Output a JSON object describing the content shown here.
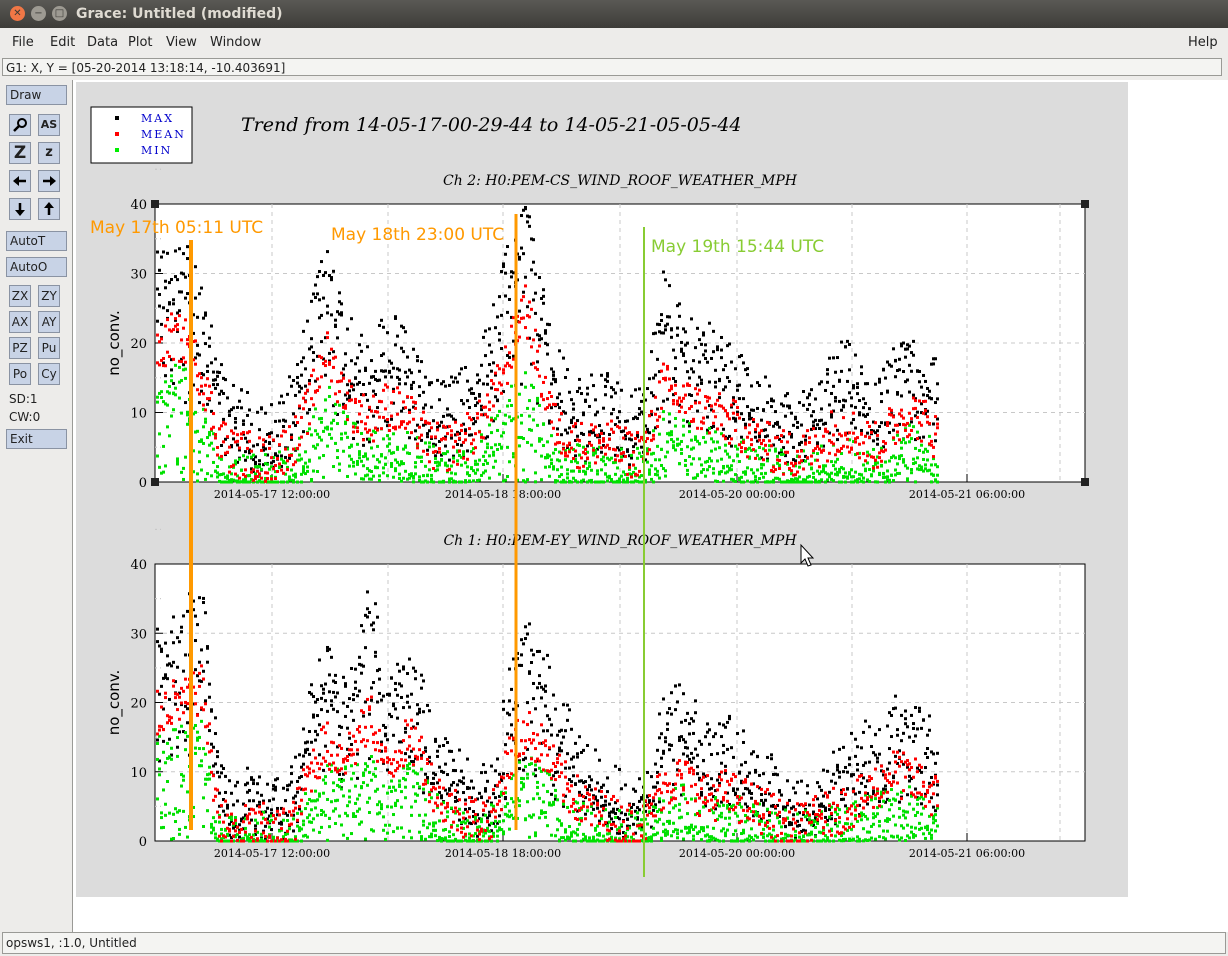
{
  "window": {
    "title": "Grace: Untitled (modified)"
  },
  "menu": {
    "file": "File",
    "edit": "Edit",
    "data": "Data",
    "plot": "Plot",
    "view": "View",
    "window": "Window",
    "help": "Help"
  },
  "coord_readout": "G1: X, Y = [05-20-2014 13:18:14, -10.403691]",
  "tools": {
    "draw": "Draw",
    "autot": "AutoT",
    "autoo": "AutoO",
    "zx": "ZX",
    "zy": "ZY",
    "ax": "AX",
    "ay": "AY",
    "pz": "PZ",
    "pu": "Pu",
    "po": "Po",
    "cy": "Cy",
    "sd": "SD:1",
    "cw": "CW:0",
    "exit": "Exit",
    "as": "AS",
    "z_big": "Z",
    "z_small": "z"
  },
  "status": "opsws1, :1.0, Untitled",
  "chart_data": {
    "title": "Trend from 14-05-17-00-29-44 to 14-05-21-05-05-44",
    "legend": {
      "placement": "top-left",
      "entries": [
        {
          "name": "MAX",
          "color": "#000000"
        },
        {
          "name": "MEAN",
          "color": "#ff0000"
        },
        {
          "name": "MIN",
          "color": "#00e000"
        }
      ]
    },
    "x_ticks": [
      "2014-05-17 12:00:00",
      "2014-05-18 18:00:00",
      "2014-05-20 00:00:00",
      "2014-05-21 06:00:00"
    ],
    "graphs": [
      {
        "subtitle": "Ch 2: H0:PEM-CS_WIND_ROOF_WEATHER_MPH",
        "ylabel": "no_conv.",
        "type": "scatter",
        "ylim": [
          0,
          40
        ],
        "y_ticks": [
          "0",
          "10",
          "20",
          "30",
          "40"
        ],
        "grid": true,
        "series_profile": [
          {
            "name": "MAX",
            "values": [
              28,
              30,
              29,
              24,
              14,
              9,
              8,
              6,
              7,
              12,
              20,
              30,
              22,
              18,
              16,
              20,
              18,
              14,
              10,
              10,
              12,
              14,
              22,
              30,
              38,
              26,
              16,
              12,
              10,
              12,
              10,
              8,
              10,
              26,
              22,
              20,
              18,
              16,
              14,
              12,
              10,
              8,
              8,
              10,
              14,
              16,
              12,
              10,
              14,
              18,
              16,
              12
            ]
          },
          {
            "name": "MEAN",
            "values": [
              18,
              21,
              20,
              15,
              7,
              4,
              4,
              3,
              4,
              6,
              11,
              19,
              14,
              10,
              9,
              11,
              10,
              8,
              5,
              5,
              6,
              8,
              12,
              18,
              26,
              16,
              8,
              6,
              5,
              6,
              5,
              4,
              5,
              14,
              12,
              11,
              10,
              9,
              8,
              6,
              5,
              4,
              4,
              5,
              7,
              8,
              6,
              5,
              8,
              10,
              9,
              6
            ]
          },
          {
            "name": "MIN",
            "values": [
              10,
              14,
              13,
              8,
              3,
              1,
              1,
              1,
              1,
              2,
              5,
              11,
              8,
              5,
              4,
              5,
              5,
              3,
              2,
              2,
              2,
              4,
              6,
              10,
              14,
              9,
              3,
              2,
              2,
              2,
              2,
              1,
              2,
              7,
              6,
              5,
              5,
              4,
              3,
              2,
              2,
              1,
              1,
              2,
              3,
              3,
              2,
              2,
              3,
              5,
              4,
              2
            ]
          }
        ]
      },
      {
        "subtitle": "Ch 1: H0:PEM-EY_WIND_ROOF_WEATHER_MPH",
        "ylabel": "no_conv.",
        "type": "scatter",
        "ylim": [
          0,
          40
        ],
        "y_ticks": [
          "0",
          "10",
          "20",
          "30",
          "40"
        ],
        "grid": true,
        "series_profile": [
          {
            "name": "MAX",
            "values": [
              26,
              28,
              30,
              36,
              12,
              4,
              6,
              5,
              4,
              8,
              18,
              24,
              20,
              22,
              34,
              18,
              24,
              22,
              14,
              10,
              8,
              6,
              8,
              20,
              28,
              26,
              18,
              14,
              10,
              8,
              6,
              4,
              6,
              16,
              18,
              16,
              12,
              14,
              12,
              10,
              8,
              4,
              4,
              6,
              8,
              10,
              12,
              14,
              18,
              16,
              14,
              12
            ]
          },
          {
            "name": "MEAN",
            "values": [
              18,
              20,
              20,
              22,
              4,
              1,
              2,
              2,
              1,
              3,
              10,
              14,
              12,
              14,
              18,
              10,
              14,
              14,
              8,
              5,
              4,
              3,
              4,
              12,
              16,
              14,
              10,
              7,
              5,
              4,
              3,
              2,
              3,
              8,
              9,
              8,
              6,
              7,
              6,
              5,
              4,
              2,
              2,
              3,
              4,
              5,
              6,
              8,
              10,
              9,
              8,
              6
            ]
          },
          {
            "name": "MIN",
            "values": [
              12,
              14,
              14,
              14,
              1,
              0,
              1,
              1,
              0,
              1,
              5,
              8,
              7,
              8,
              9,
              5,
              8,
              8,
              4,
              2,
              1,
              1,
              2,
              6,
              9,
              8,
              5,
              3,
              2,
              2,
              1,
              1,
              1,
              4,
              5,
              4,
              3,
              3,
              3,
              2,
              2,
              1,
              1,
              1,
              2,
              2,
              3,
              4,
              5,
              5,
              4,
              3
            ]
          }
        ]
      }
    ],
    "annotations": [
      {
        "text": "May 17th  05:11 UTC",
        "color": "#ff9900"
      },
      {
        "text": "May 18th 23:00 UTC",
        "color": "#ff9900"
      },
      {
        "text": "May 19th 15:44 UTC",
        "color": "#88cc33"
      }
    ]
  }
}
